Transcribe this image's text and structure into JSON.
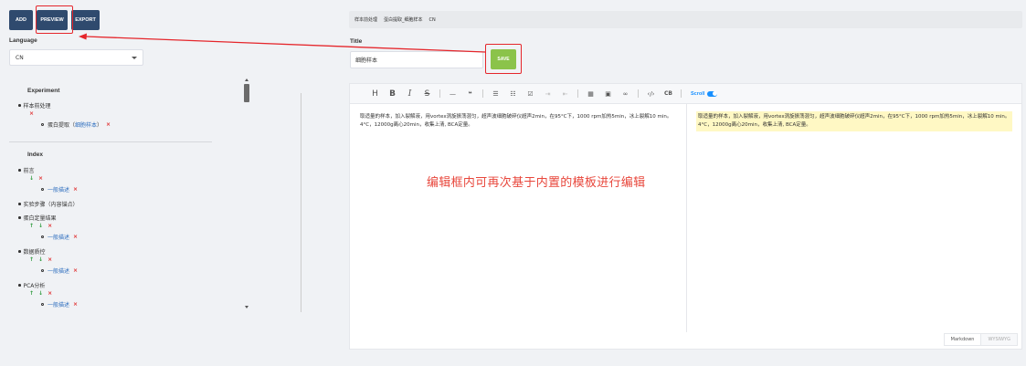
{
  "toolbar_buttons": {
    "add": "ADD",
    "preview": "PREVIEW",
    "export": "EXPORT"
  },
  "language": {
    "label": "Language",
    "value": "CN"
  },
  "tree": {
    "experiment_title": "Experiment",
    "experiment_item": "样本前处理",
    "experiment_sub_prefix": "蛋白提取（",
    "experiment_sub_link": "细胞样本",
    "experiment_sub_suffix": "）",
    "index_title": "Index",
    "index_items": [
      {
        "label": "前言",
        "sub": "一般描述"
      },
      {
        "label": "实验步骤（内容锚点）"
      },
      {
        "label": "蛋白定量结果",
        "sub": "一般描述"
      },
      {
        "label": "数据质控",
        "sub": "一般描述"
      },
      {
        "label": "PCA分析",
        "sub": "一般描述"
      }
    ]
  },
  "breadcrumb": [
    "样本前处理",
    "蛋白提取_细胞样本",
    "CN"
  ],
  "title_field": {
    "label": "Title",
    "value": "细胞样本"
  },
  "save_label": "SAVE",
  "editor": {
    "source_text": "取适量的样本，加入裂解液，用vortex涡旋振荡混匀，超声波细胞破碎仪超声2min，在95°C下，1000 rpm加热5min，冰上裂解10 min。4°C，12000g离心20min，收集上清, BCA定量。",
    "preview_text": "取适量的样本，加入裂解液，用vortex涡旋振荡混匀，超声波细胞破碎仪超声2min，在95°C下，1000 rpm加热5min，冰上裂解10 min。4°C，12000g离心20min，收集上清, BCA定量。",
    "note": "编辑框内可再次基于内置的模板进行编辑",
    "scroll_label": "Scroll",
    "mode_markdown": "Markdown",
    "mode_wysiwyg": "WYSIWYG"
  }
}
